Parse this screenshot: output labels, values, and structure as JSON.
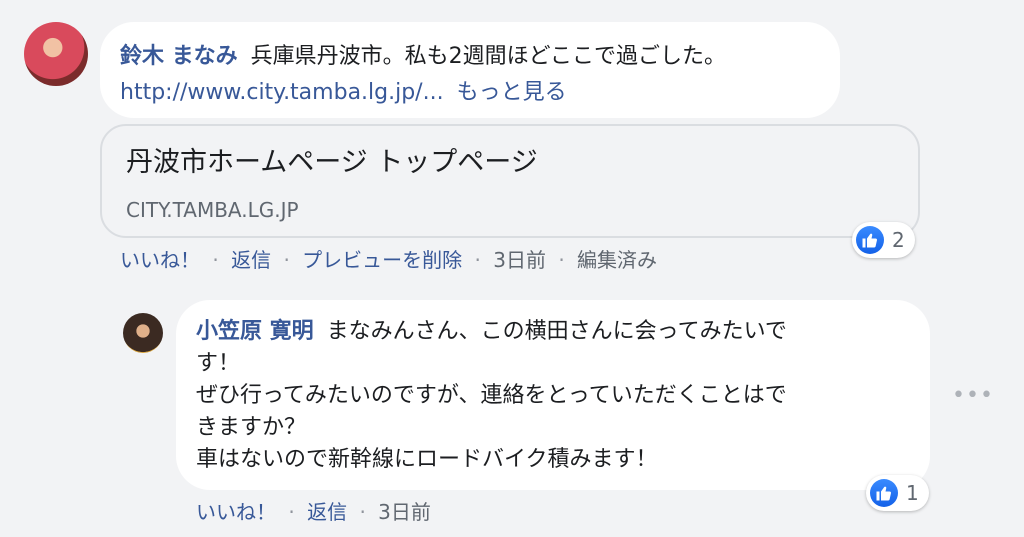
{
  "comment1": {
    "author": "鈴木 まなみ",
    "text": "兵庫県丹波市。私も2週間ほどここで過ごした。",
    "link_text": "http://www.city.tamba.lg.jp/...",
    "more_label": "もっと見る",
    "preview": {
      "title": "丹波市ホームページ トップページ",
      "domain": "CITY.TAMBA.LG.JP"
    },
    "actions": {
      "like": "いいね！",
      "reply": "返信",
      "remove_preview": "プレビューを削除",
      "time": "3日前",
      "edited": "編集済み"
    },
    "reaction_count": "2"
  },
  "comment2": {
    "author": "小笠原 寛明",
    "lines": [
      "まなみんさん、この横田さんに会ってみたいで",
      "す！",
      "ぜひ行ってみたいのですが、連絡をとっていただくことはで",
      "きますか？",
      "車はないので新幹線にロードバイク積みます！"
    ],
    "actions": {
      "like": "いいね！",
      "reply": "返信",
      "time": "3日前"
    },
    "reaction_count": "1"
  },
  "separator": "·",
  "more_icon": "•••",
  "colors": {
    "link": "#385898",
    "like_blue": "#1877f2",
    "bubble": "#ffffff",
    "background": "#f2f3f5"
  },
  "icons": [
    "like-thumb-icon",
    "more-options-icon"
  ]
}
